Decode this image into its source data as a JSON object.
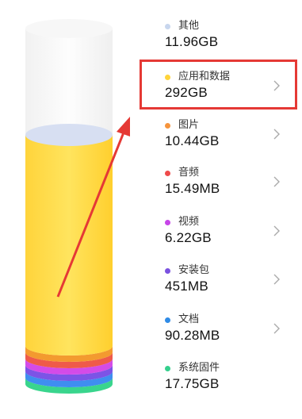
{
  "storage": {
    "items": [
      {
        "label": "其他",
        "size": "11.96GB",
        "color": "#c8d6ee",
        "fraction": 0.04,
        "has_chevron": false
      },
      {
        "label": "应用和数据",
        "size": "292GB",
        "color": "#ffd43b",
        "fraction": 0.88,
        "has_chevron": true,
        "highlighted": true
      },
      {
        "label": "图片",
        "size": "10.44GB",
        "color": "#f6943c",
        "fraction": 0.015,
        "has_chevron": true
      },
      {
        "label": "音频",
        "size": "15.49MB",
        "color": "#ef4b4b",
        "fraction": 0.01,
        "has_chevron": true
      },
      {
        "label": "视频",
        "size": "6.22GB",
        "color": "#c745e8",
        "fraction": 0.012,
        "has_chevron": true
      },
      {
        "label": "安装包",
        "size": "451MB",
        "color": "#7a52e0",
        "fraction": 0.01,
        "has_chevron": true
      },
      {
        "label": "文档",
        "size": "90.28MB",
        "color": "#2f8be6",
        "fraction": 0.01,
        "has_chevron": true
      },
      {
        "label": "系统固件",
        "size": "17.75GB",
        "color": "#35d08d",
        "fraction": 0.02,
        "has_chevron": false
      }
    ]
  },
  "cylinder_bands": [
    "#f39a2f",
    "#ef5a4a",
    "#d44be8",
    "#7c54e6",
    "#3f8ef0",
    "#39d58d"
  ],
  "highlight_color": "#e53935",
  "chevron_icon": "chevron-right-icon"
}
